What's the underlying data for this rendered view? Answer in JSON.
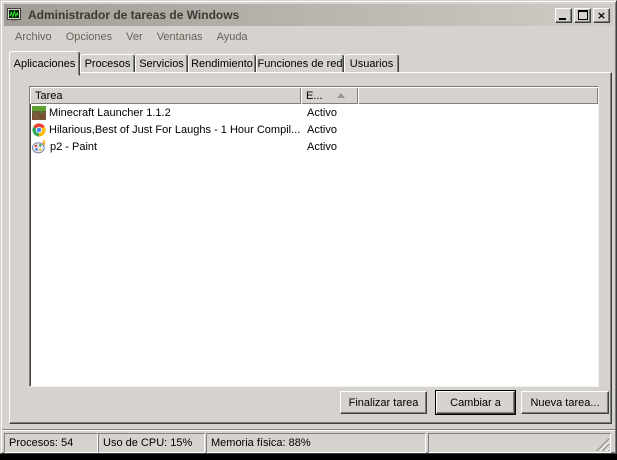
{
  "colors": {
    "window_bg": "#d6d3ce",
    "titlebar_left": "#a19d97",
    "titlebar_right": "#cfccc6",
    "title_text": "#3b3934",
    "list_bg": "#ffffff",
    "sort_arrow": "#9a958c"
  },
  "window": {
    "title": "Administrador de tareas de Windows",
    "close_glyph": "×"
  },
  "menu": {
    "items": [
      {
        "label": "Archivo"
      },
      {
        "label": "Opciones"
      },
      {
        "label": "Ver"
      },
      {
        "label": "Ventanas"
      },
      {
        "label": "Ayuda"
      }
    ]
  },
  "tabs": [
    {
      "label": "Aplicaciones",
      "active": true
    },
    {
      "label": "Procesos",
      "active": false
    },
    {
      "label": "Servicios",
      "active": false
    },
    {
      "label": "Rendimiento",
      "active": false
    },
    {
      "label": "Funciones de red",
      "active": false
    },
    {
      "label": "Usuarios",
      "active": false
    }
  ],
  "task_list": {
    "columns": [
      {
        "label": "Tarea"
      },
      {
        "label": "E...",
        "sort": "asc"
      }
    ],
    "rows": [
      {
        "icon": "minecraft-icon",
        "task": "Minecraft Launcher 1.1.2",
        "status": "Activo"
      },
      {
        "icon": "chrome-icon",
        "task": "Hilarious,Best of Just For Laughs - 1 Hour Compil...",
        "status": "Activo"
      },
      {
        "icon": "paint-icon",
        "task": "p2 - Paint",
        "status": "Activo"
      }
    ]
  },
  "buttons": {
    "end_task": "Finalizar tarea",
    "switch_to": "Cambiar a",
    "new_task": "Nueva tarea..."
  },
  "status_bar": {
    "processes": "Procesos: 54",
    "cpu": "Uso de CPU: 15%",
    "memory": "Memoria física: 88%"
  }
}
